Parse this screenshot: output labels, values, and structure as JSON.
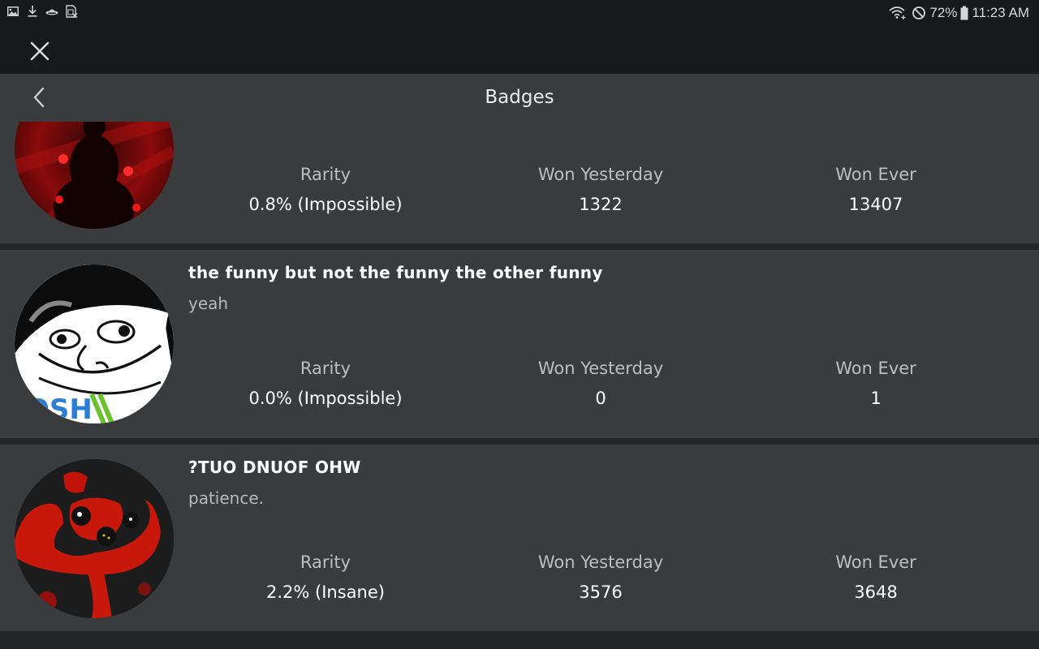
{
  "status_bar": {
    "left_icons": [
      "gallery-icon",
      "download-icon",
      "ufo-app-icon",
      "sim-card-off-icon"
    ],
    "right_icons": [
      "wifi-icon",
      "do-not-disturb-icon",
      "battery-icon"
    ],
    "battery": "72%",
    "time": "11:23 AM"
  },
  "topbar": {
    "close_icon": "close-icon"
  },
  "header": {
    "title": "Badges",
    "back_icon": "chevron-left-icon"
  },
  "stat_labels": {
    "rarity": "Rarity",
    "won_yesterday": "Won Yesterday",
    "won_ever": "Won Ever"
  },
  "badges": [
    {
      "name": "",
      "description": "",
      "rarity": "0.8% (Impossible)",
      "won_yesterday": "1322",
      "won_ever": "13407",
      "image": "red-dark-figure-badge"
    },
    {
      "name": "the funny but not the funny the other funny",
      "description": "yeah",
      "rarity": "0.0% (Impossible)",
      "won_yesterday": "0",
      "won_ever": "1",
      "image": "meme-face-badge"
    },
    {
      "name": "?TUO DNUOF OHW",
      "description": "patience.",
      "rarity": "2.2% (Insane)",
      "won_yesterday": "3576",
      "won_ever": "3648",
      "image": "red-creature-badge"
    }
  ]
}
